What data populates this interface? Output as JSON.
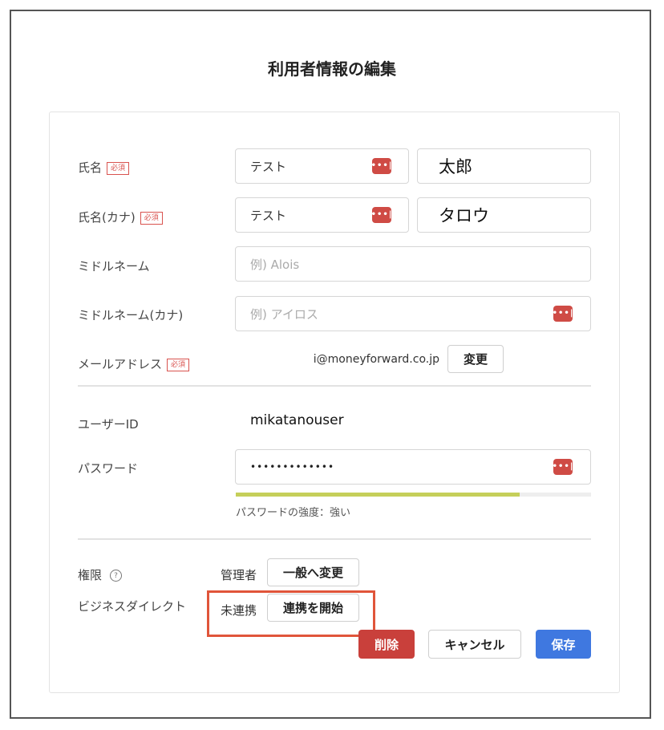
{
  "dialog": {
    "title": "利用者情報の編集"
  },
  "required_badge": "必須",
  "name": {
    "label": "氏名",
    "last": "テスト",
    "first": "太郎"
  },
  "name_kana": {
    "label": "氏名(カナ)",
    "last": "テスト",
    "first": "タロウ"
  },
  "middle_name": {
    "label": "ミドルネーム",
    "placeholder": "例) Alois"
  },
  "middle_name_kana": {
    "label": "ミドルネーム(カナ)",
    "placeholder": "例) アイロス"
  },
  "email": {
    "label": "メールアドレス",
    "value": "i@moneyforward.co.jp",
    "change_label": "変更"
  },
  "user_id": {
    "label": "ユーザーID",
    "value": "mikatanouser"
  },
  "password": {
    "label": "パスワード",
    "value": "•••••••••••••",
    "strength_text": "パスワードの強度：強い",
    "strength_fraction": 0.8
  },
  "permission": {
    "label": "権限",
    "help_icon": "question-circle-icon",
    "value": "管理者",
    "change_label": "一般へ変更"
  },
  "business_direct": {
    "label": "ビジネスダイレクト",
    "status": "未連携",
    "start_label": "連携を開始"
  },
  "footer": {
    "delete_label": "削除",
    "cancel_label": "キャンセル",
    "save_label": "保存"
  },
  "icons": {
    "password_manager": "password-manager-icon",
    "help": "question-circle-icon"
  },
  "colors": {
    "danger": "#c9403b",
    "primary": "#3f78e0",
    "highlight": "#e0553a",
    "strength": "#c5cf5a"
  }
}
